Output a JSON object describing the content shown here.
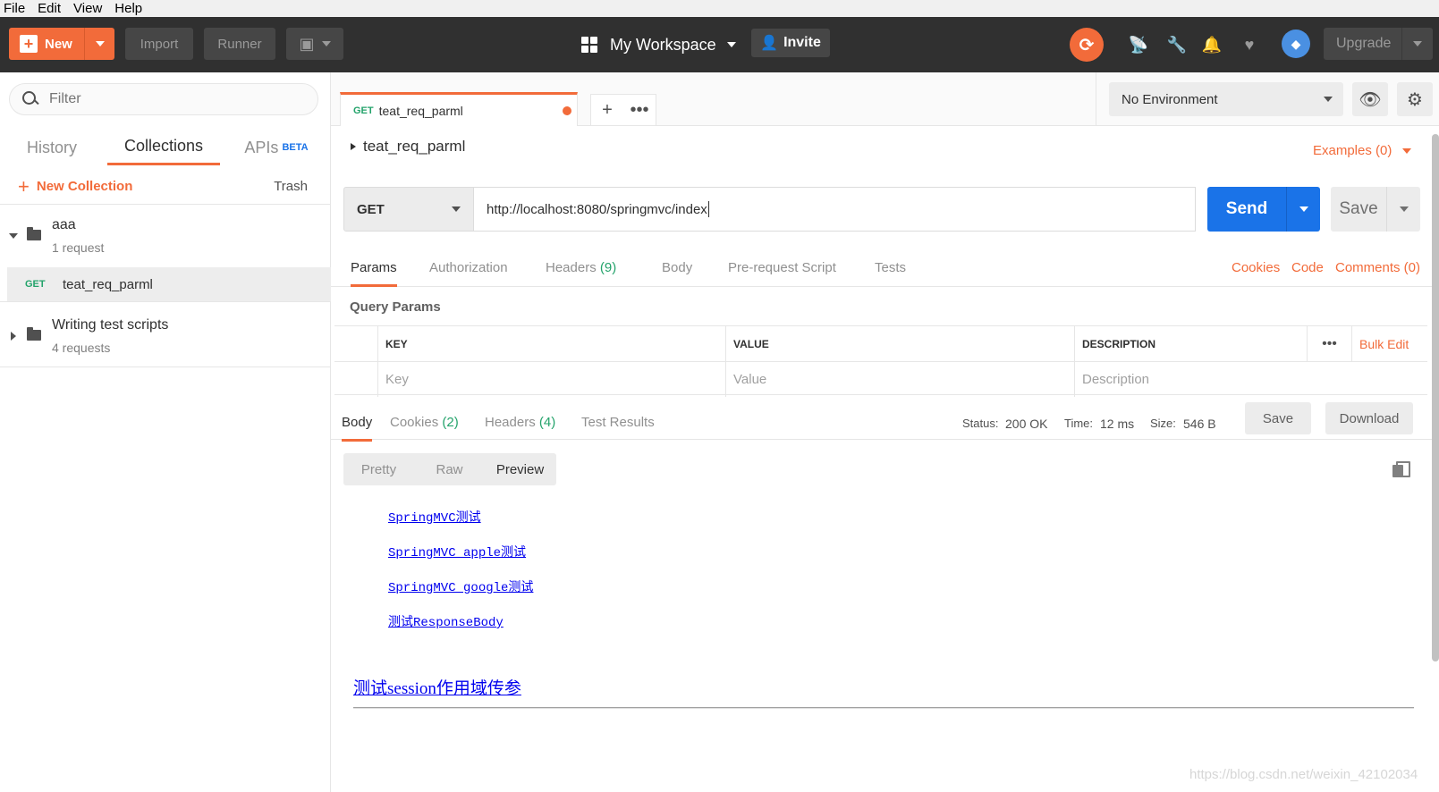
{
  "menu": [
    "File",
    "Edit",
    "View",
    "Help"
  ],
  "header": {
    "new_label": "New",
    "import_label": "Import",
    "runner_label": "Runner",
    "workspace_label": "My Workspace",
    "invite_label": "Invite",
    "upgrade_label": "Upgrade"
  },
  "sidebar": {
    "filter_placeholder": "Filter",
    "tabs": [
      "History",
      "Collections",
      "APIs"
    ],
    "beta_label": "BETA",
    "new_collection_label": "New Collection",
    "trash_label": "Trash",
    "collections": [
      {
        "name": "aaa",
        "sub": "1 request"
      },
      {
        "name": "Writing test scripts",
        "sub": "4 requests"
      }
    ],
    "request": {
      "method": "GET",
      "name": "teat_req_parml"
    }
  },
  "tab": {
    "method": "GET",
    "name": "teat_req_parml"
  },
  "environment": {
    "selected": "No Environment"
  },
  "request": {
    "breadcrumb": "teat_req_parml",
    "examples_label": "Examples (0)",
    "method": "GET",
    "url": "http://localhost:8080/springmvc/index",
    "send_label": "Send",
    "save_label": "Save"
  },
  "request_tabs": {
    "params": "Params",
    "authorization": "Authorization",
    "headers": "Headers",
    "headers_count": "(9)",
    "body": "Body",
    "prerequest": "Pre-request Script",
    "tests": "Tests",
    "cookies": "Cookies",
    "code": "Code",
    "comments": "Comments (0)"
  },
  "query_params": {
    "title": "Query Params",
    "columns": [
      "KEY",
      "VALUE",
      "DESCRIPTION"
    ],
    "placeholders": [
      "Key",
      "Value",
      "Description"
    ],
    "bulk_edit": "Bulk Edit"
  },
  "response": {
    "tabs": {
      "body": "Body",
      "cookies": "Cookies",
      "cookies_count": "(2)",
      "headers": "Headers",
      "headers_count": "(4)",
      "test_results": "Test Results"
    },
    "status_label": "Status:",
    "status_value": "200 OK",
    "time_label": "Time:",
    "time_value": "12 ms",
    "size_label": "Size:",
    "size_value": "546 B",
    "save_label": "Save",
    "download_label": "Download",
    "view_tabs": [
      "Pretty",
      "Raw",
      "Preview"
    ],
    "preview_links": [
      "SpringMVC测试",
      "SpringMVC_apple测试",
      "SpringMVC_google测试",
      "测试ResponseBody"
    ],
    "session_link": "测试session作用域传参"
  },
  "watermark": "https://blog.csdn.net/weixin_42102034"
}
